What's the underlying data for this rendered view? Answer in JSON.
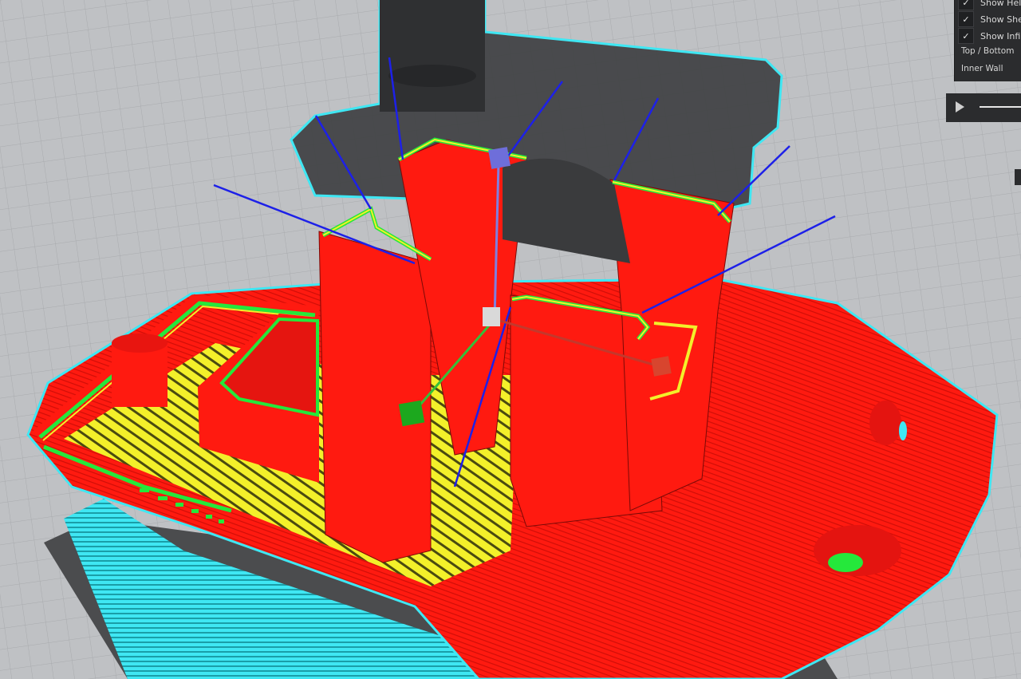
{
  "layer_view_panel": {
    "options": [
      {
        "label": "Show Helpers",
        "checked": true
      },
      {
        "label": "Show Shell",
        "checked": true
      },
      {
        "label": "Show Infill",
        "checked": true
      }
    ],
    "legend": [
      "Top / Bottom",
      "Inner Wall"
    ],
    "check_glyph": "✓"
  },
  "colors": {
    "wall_red": "#ff1a10",
    "skin_yellow": "#f3f02a",
    "inner_wall_green": "#25e83b",
    "helper_cyan": "#3fe7f3",
    "travel_blue": "#1d20e8",
    "build_plate_gray": "#bfc1c4",
    "panel_bg": "#2b2c2e"
  },
  "icons": [
    "play-icon",
    "checkmark-icon"
  ]
}
